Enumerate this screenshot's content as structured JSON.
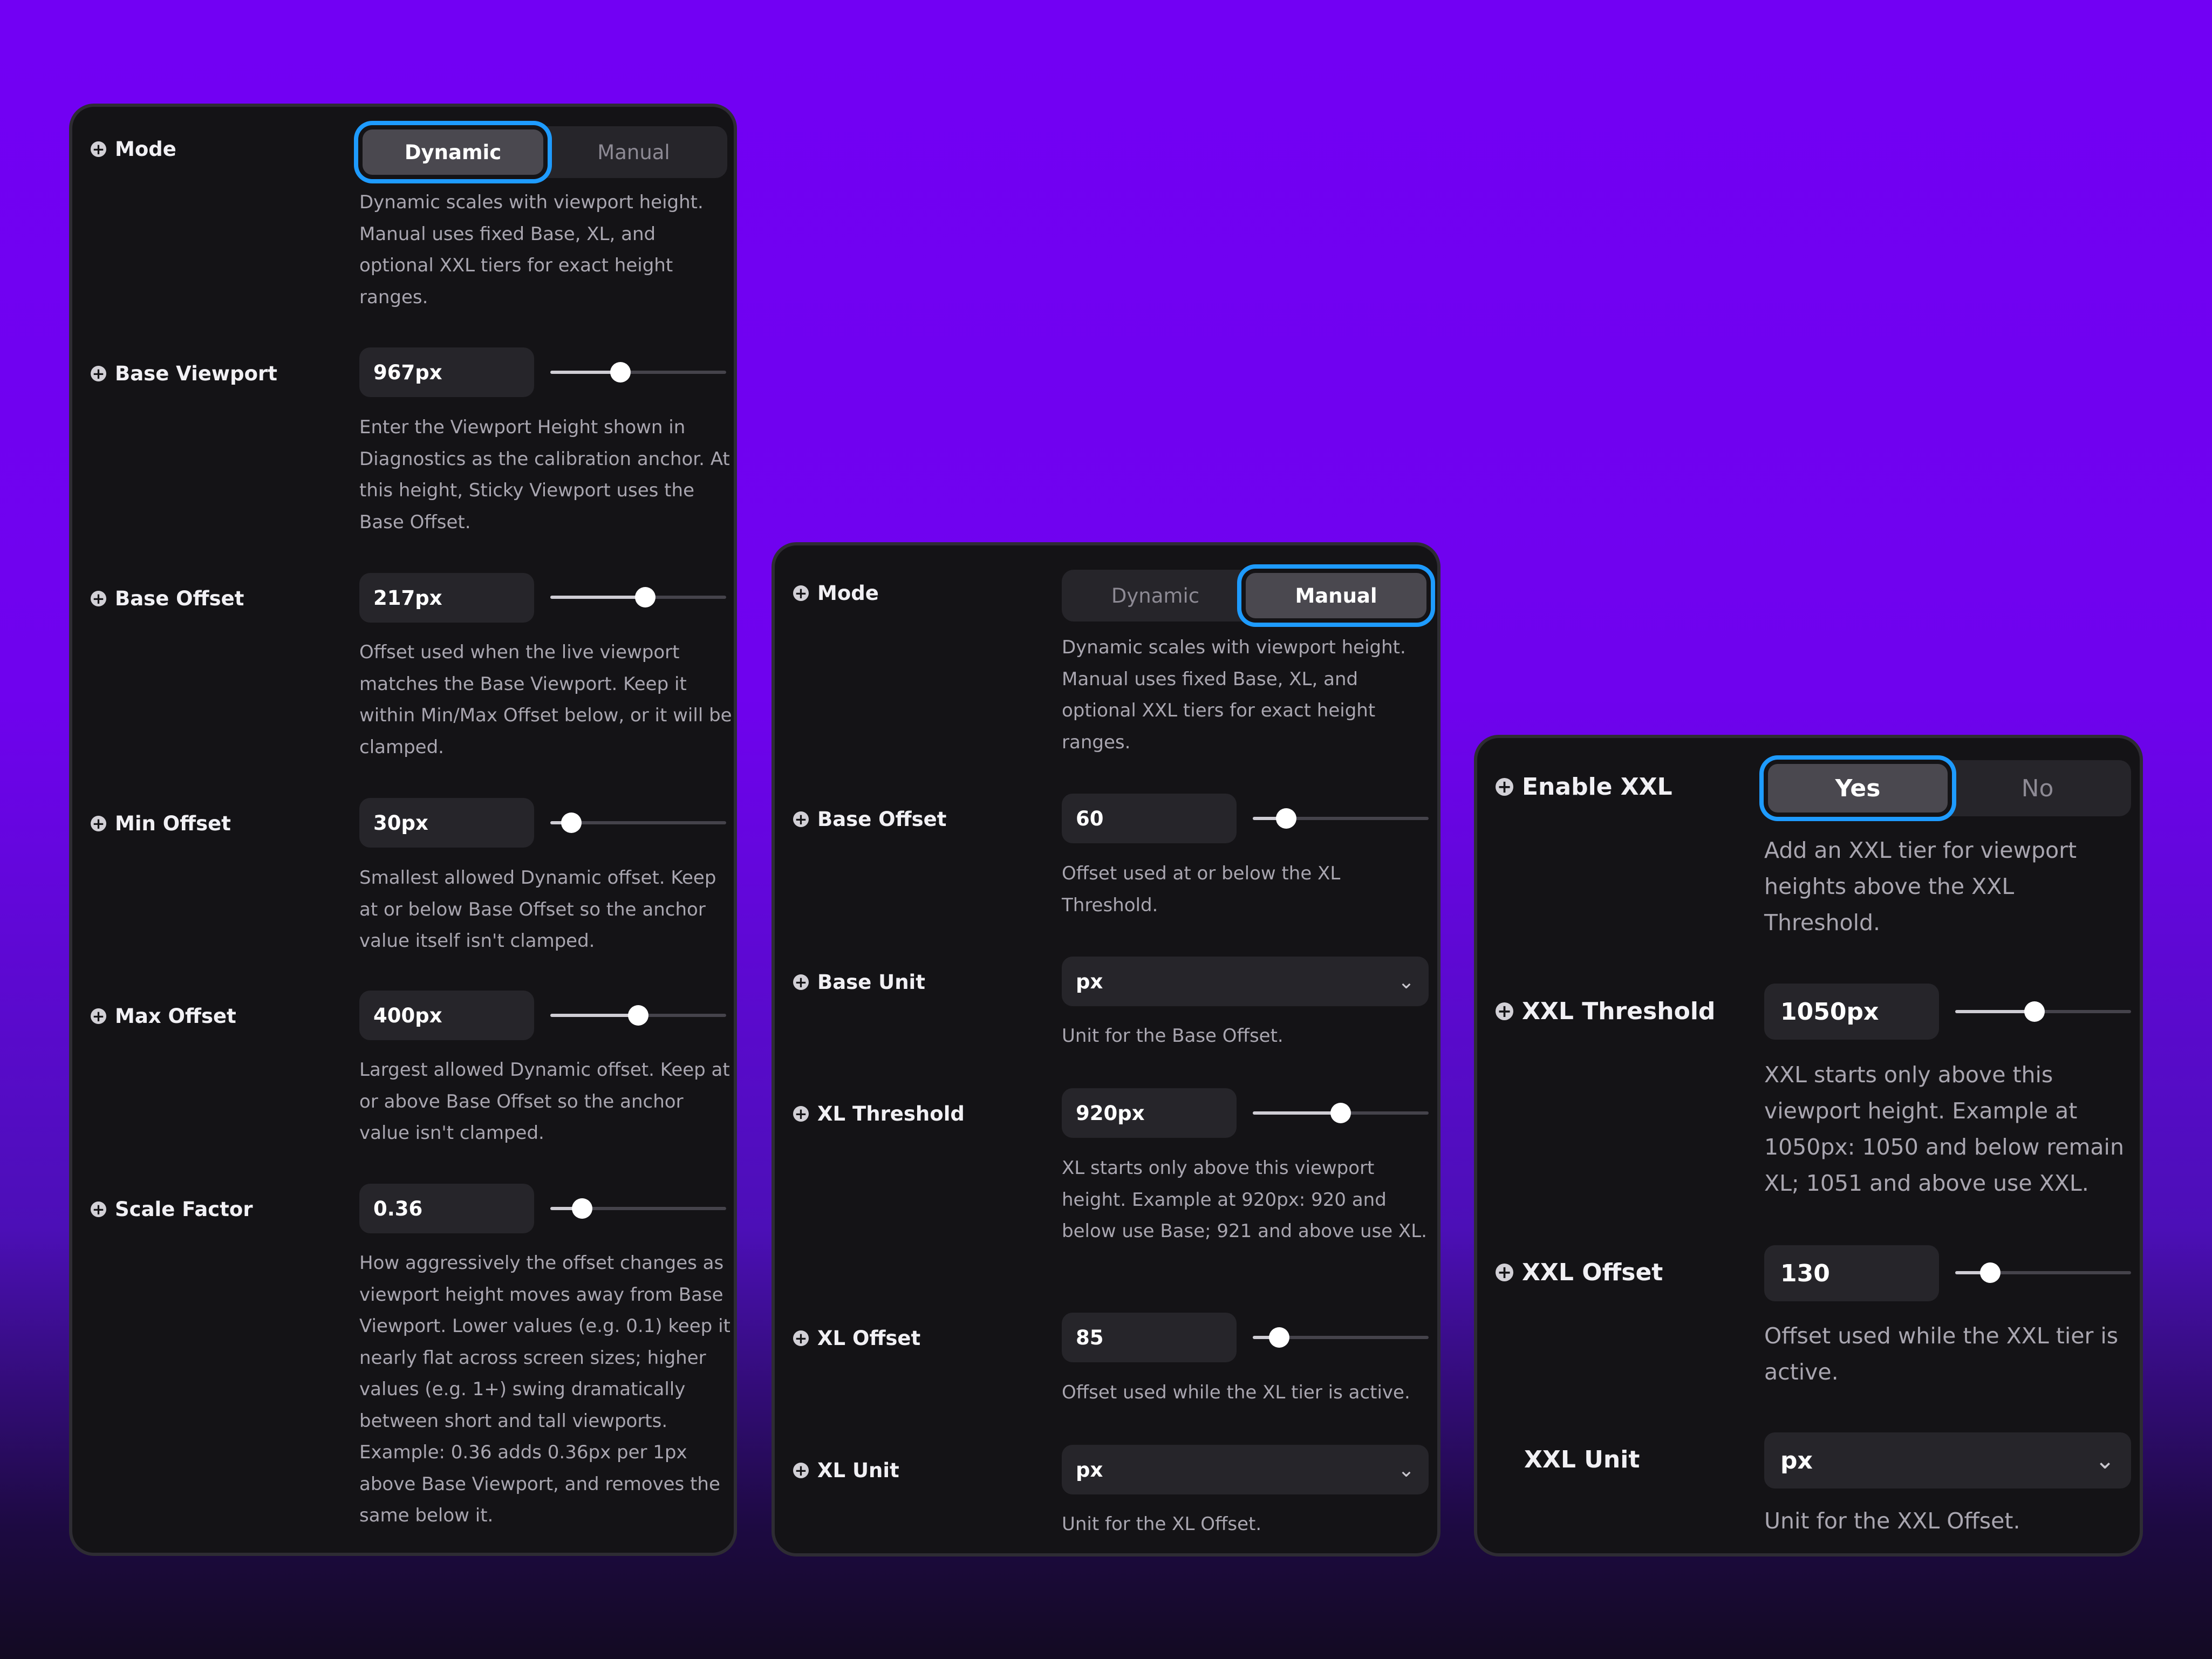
{
  "colors": {
    "panel_bg": "#141316",
    "control_bg": "#26252a",
    "active_segment_bg": "#4a484f",
    "focus_ring": "#1e9bff",
    "text_primary": "#ffffff",
    "text_secondary": "#a9a6b0"
  },
  "icons": {
    "field_marker": "plus-circle-icon",
    "select_chevron": "chevron-down-icon"
  },
  "panel_dynamic": {
    "mode": {
      "label": "Mode",
      "options": [
        "Dynamic",
        "Manual"
      ],
      "selected": "Dynamic",
      "description": "Dynamic scales with viewport height. Manual uses fixed Base, XL, and optional XXL tiers for exact height ranges."
    },
    "base_viewport": {
      "label": "Base Viewport",
      "value": "967px",
      "slider_fraction": 0.4,
      "description": "Enter the Viewport Height shown in Diagnostics as the calibration anchor. At this height, Sticky Viewport uses the Base Offset."
    },
    "base_offset": {
      "label": "Base Offset",
      "value": "217px",
      "slider_fraction": 0.54,
      "description": "Offset used when the live viewport matches the Base Viewport. Keep it within Min/Max Offset below, or it will be clamped."
    },
    "min_offset": {
      "label": "Min Offset",
      "value": "30px",
      "slider_fraction": 0.12,
      "description": "Smallest allowed Dynamic offset. Keep at or below Base Offset so the anchor value itself isn't clamped."
    },
    "max_offset": {
      "label": "Max Offset",
      "value": "400px",
      "slider_fraction": 0.5,
      "description": "Largest allowed Dynamic offset. Keep at or above Base Offset so the anchor value isn't clamped."
    },
    "scale_factor": {
      "label": "Scale Factor",
      "value": "0.36",
      "slider_fraction": 0.18,
      "description": "How aggressively the offset changes as viewport height moves away from Base Viewport. Lower values (e.g. 0.1) keep it nearly flat across screen sizes; higher values (e.g. 1+) swing dramatically between short and tall viewports. Example: 0.36 adds 0.36px per 1px above Base Viewport, and removes the same below it."
    }
  },
  "panel_manual": {
    "mode": {
      "label": "Mode",
      "options": [
        "Dynamic",
        "Manual"
      ],
      "selected": "Manual",
      "description": "Dynamic scales with viewport height. Manual uses fixed Base, XL, and optional XXL tiers for exact height ranges."
    },
    "base_offset": {
      "label": "Base Offset",
      "value": "60",
      "slider_fraction": 0.19,
      "description": "Offset used at or below the XL Threshold."
    },
    "base_unit": {
      "label": "Base Unit",
      "value": "px",
      "description": "Unit for the Base Offset."
    },
    "xl_threshold": {
      "label": "XL Threshold",
      "value": "920px",
      "slider_fraction": 0.5,
      "description": "XL starts only above this viewport height. Example at 920px: 920 and below use Base; 921 and above use XL."
    },
    "xl_offset": {
      "label": "XL Offset",
      "value": "85",
      "slider_fraction": 0.15,
      "description": "Offset used while the XL tier is active."
    },
    "xl_unit": {
      "label": "XL Unit",
      "value": "px",
      "description": "Unit for the XL Offset."
    }
  },
  "panel_xxl": {
    "enable_xxl": {
      "label": "Enable XXL",
      "options": [
        "Yes",
        "No"
      ],
      "selected": "Yes",
      "description": "Add an XXL tier for viewport heights above the XXL Threshold."
    },
    "xxl_threshold": {
      "label": "XXL Threshold",
      "value": "1050px",
      "slider_fraction": 0.45,
      "description": "XXL starts only above this viewport height. Example at 1050px: 1050 and below remain XL; 1051 and above use XXL."
    },
    "xxl_offset": {
      "label": "XXL Offset",
      "value": "130",
      "slider_fraction": 0.2,
      "description": "Offset used while the XXL tier is active."
    },
    "xxl_unit": {
      "label": "XXL Unit",
      "value": "px",
      "description": "Unit for the XXL Offset."
    }
  }
}
